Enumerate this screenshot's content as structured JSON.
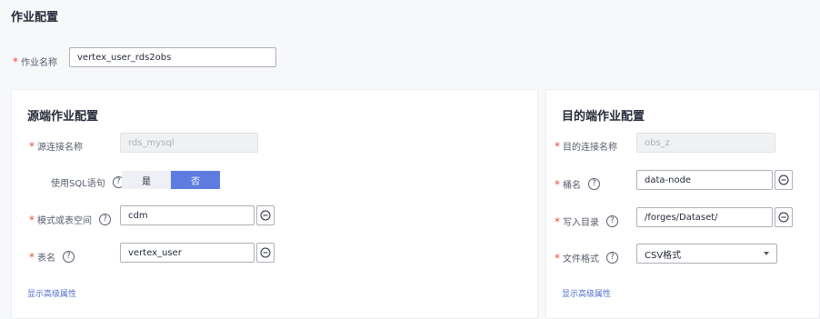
{
  "page": {
    "title": "作业配置"
  },
  "job_name": {
    "label": "作业名称",
    "value": "vertex_user_rds2obs"
  },
  "source": {
    "title": "源端作业配置",
    "connection_label": "源连接名称",
    "connection_value": "rds_mysql",
    "use_sql_label": "使用SQL语句",
    "use_sql_options": [
      "是",
      "否"
    ],
    "use_sql_selected": "否",
    "schema_label": "模式或表空间",
    "schema_value": "cdm",
    "table_label": "表名",
    "table_value": "vertex_user",
    "advanced_link": "显示高级属性"
  },
  "target": {
    "title": "目的端作业配置",
    "connection_label": "目的连接名称",
    "connection_value": "obs_z",
    "bucket_label": "桶名",
    "bucket_value": "data-node",
    "dir_label": "写入目录",
    "dir_value": "/forges/Dataset/",
    "format_label": "文件格式",
    "format_value": "CSV格式",
    "advanced_link": "显示高级属性"
  },
  "icons": {
    "required": "*",
    "help": "?"
  },
  "colors": {
    "accent": "#5e7ce0",
    "link": "#526ecc",
    "required": "#e6503c"
  }
}
